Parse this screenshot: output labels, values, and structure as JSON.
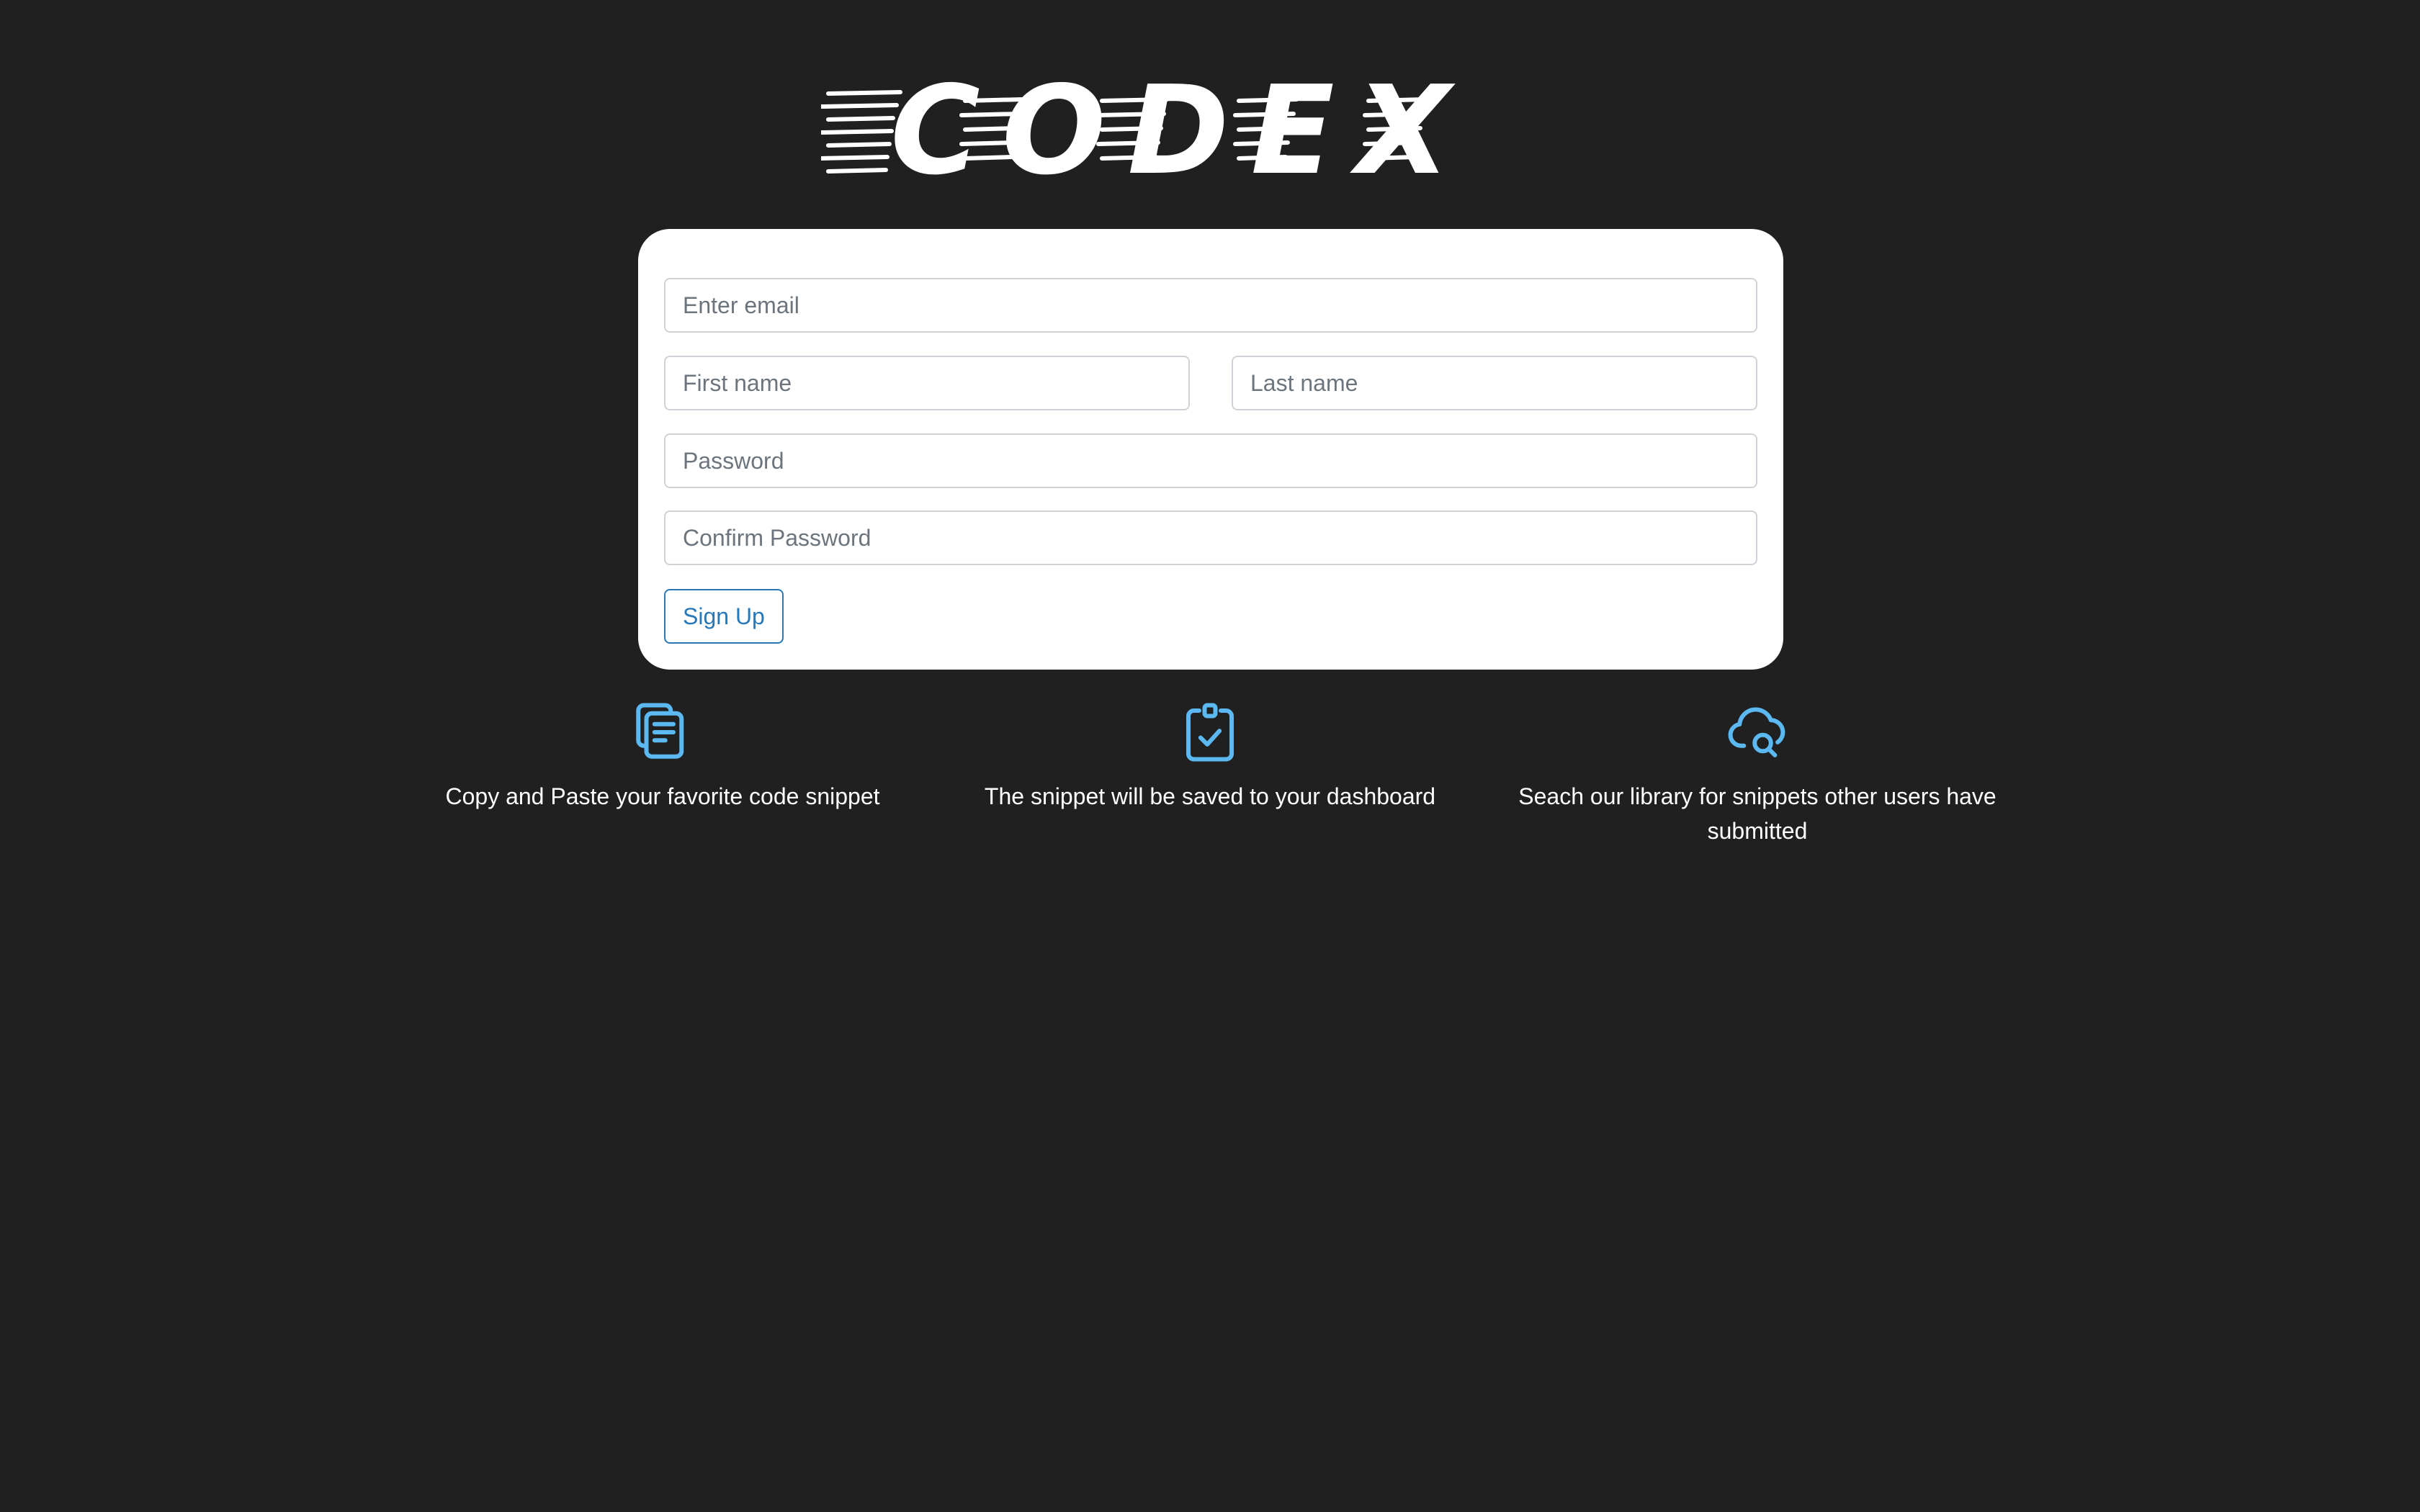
{
  "brand": {
    "name": "CODEX"
  },
  "signup_form": {
    "email_placeholder": "Enter email",
    "first_name_placeholder": "First name",
    "last_name_placeholder": "Last name",
    "password_placeholder": "Password",
    "confirm_password_placeholder": "Confirm Password",
    "submit_label": "Sign Up"
  },
  "features": [
    {
      "icon": "copy-document-icon",
      "text": "Copy and Paste your favorite code snippet"
    },
    {
      "icon": "clipboard-check-icon",
      "text": "The snippet will be saved to your dashboard"
    },
    {
      "icon": "cloud-search-icon",
      "text": "Seach our library for snippets other users have submitted"
    }
  ],
  "colors": {
    "background": "#202020",
    "card": "#ffffff",
    "accent": "#2778b8",
    "icon": "#5bb8f0"
  }
}
